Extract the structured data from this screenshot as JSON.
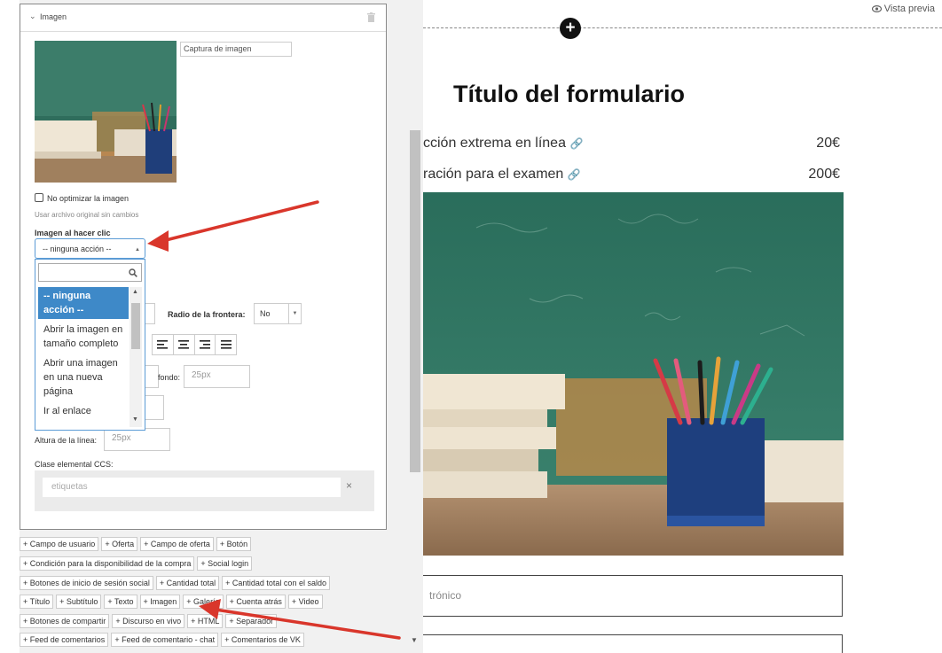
{
  "panel": {
    "title": "Imagen",
    "caption_placeholder": "Captura de imagen",
    "no_optimize_label": "No optimizar la imagen",
    "no_optimize_hint": "Usar archivo original sin cambios",
    "click_action_label": "Imagen al hacer clic",
    "click_action_value": "-- ninguna acción --",
    "dropdown_options": [
      "-- ninguna acción --",
      "Abrir la imagen en tamaño completo",
      "Abrir una imagen en una nueva página",
      "Ir al enlace"
    ],
    "border_radius_label": "Radio de la frontera:",
    "border_radius_value": "No",
    "background_label": "fondo:",
    "background_value": "25px",
    "line_height_label": "Altura de la línea:",
    "line_height_value": "25px",
    "css_class_label": "Clase elemental CCS:",
    "tags_placeholder": "etiquetas",
    "tags_clear": "×"
  },
  "add_buttons": [
    [
      "+ Campo de usuario",
      "+ Oferta",
      "+ Campo de oferta",
      "+ Botón"
    ],
    [
      "+ Condición para la disponibilidad de la compra",
      "+ Social login"
    ],
    [
      "+ Botones de inicio de sesión social",
      "+ Cantidad total",
      "+ Cantidad total con el saldo"
    ],
    [
      "+ Título",
      "+ Subtítulo",
      "+ Texto",
      "+ Imagen",
      "+ Galería",
      "+ Cuenta atrás",
      "+ Video"
    ],
    [
      "+ Botones de compartir",
      "+ Discurso en vivo",
      "+ HTML",
      "+ Separador"
    ],
    [
      "+ Feed de comentarios",
      "+ Feed de comentario - chat",
      "+ Comentarios de VK"
    ]
  ],
  "preview": {
    "preview_label": "Vista previa",
    "form_title": "Título del formulario",
    "offers": [
      {
        "name": "cción extrema en línea",
        "price": "20€"
      },
      {
        "name": "ración para el examen",
        "price": "200€"
      }
    ],
    "email_placeholder": "trónico"
  },
  "colors": {
    "arrow": "#d9362b",
    "selected_option": "#3e89c8",
    "focus_border": "#5b9bd5"
  }
}
